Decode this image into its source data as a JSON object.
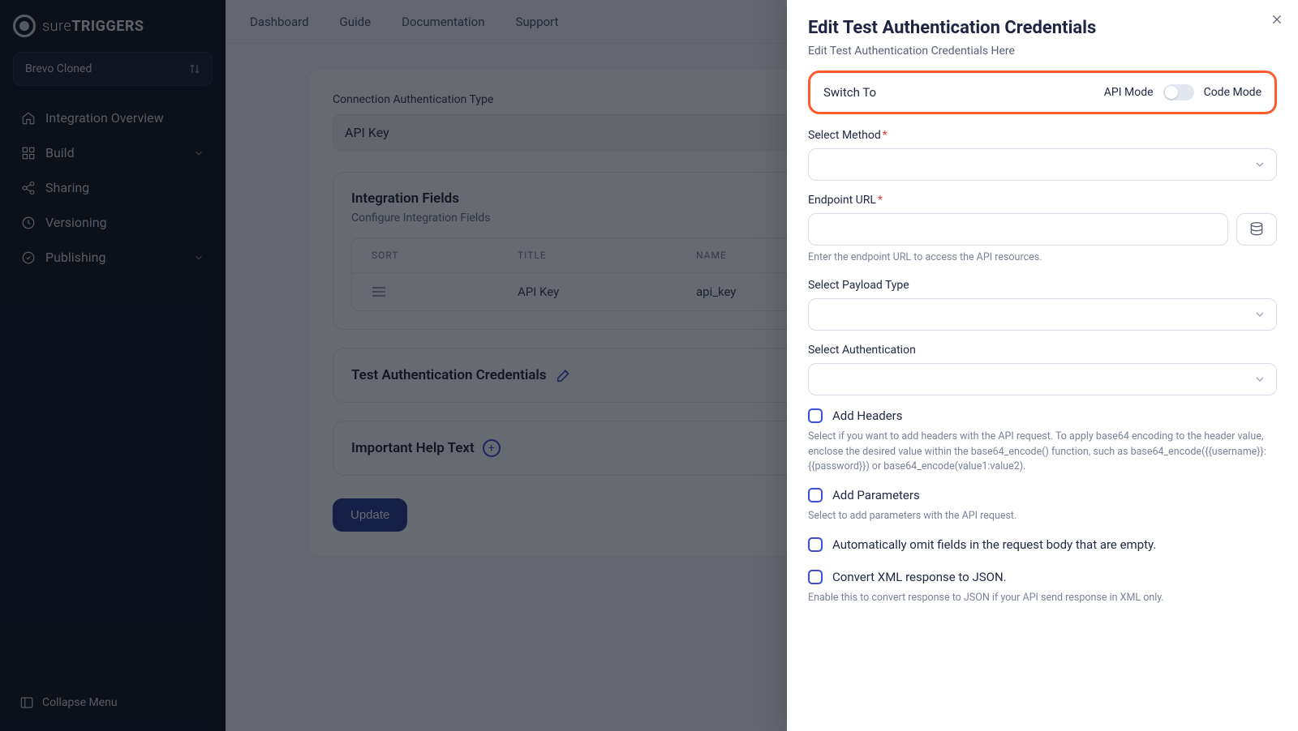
{
  "brand": {
    "prefix": "sure",
    "strong": "TRIGGERS"
  },
  "project": {
    "name": "Brevo Cloned"
  },
  "topnav": {
    "dashboard": "Dashboard",
    "guide": "Guide",
    "documentation": "Documentation",
    "support": "Support"
  },
  "sidebar": {
    "items": [
      {
        "label": "Integration Overview"
      },
      {
        "label": "Build"
      },
      {
        "label": "Sharing"
      },
      {
        "label": "Versioning"
      },
      {
        "label": "Publishing"
      }
    ],
    "footer": "Collapse Menu"
  },
  "main": {
    "conn_label": "Connection Authentication Type",
    "conn_value": "API Key",
    "fields_panel": {
      "title": "Integration Fields",
      "sub": "Configure Integration Fields",
      "thead": {
        "sort": "SORT",
        "title": "TITLE",
        "name": "NAME"
      },
      "row": {
        "title": "API Key",
        "name": "api_key"
      }
    },
    "test_row": {
      "title": "Test Authentication Credentials"
    },
    "help_row": {
      "title": "Important Help Text"
    },
    "update": "Update"
  },
  "drawer": {
    "title": "Edit Test Authentication Credentials",
    "subtitle": "Edit Test Authentication Credentials Here",
    "switch": {
      "label": "Switch To",
      "left": "API Mode",
      "right": "Code Mode"
    },
    "method_label": "Select Method",
    "endpoint_label": "Endpoint URL",
    "endpoint_help": "Enter the endpoint URL to access the API resources.",
    "payload_label": "Select Payload Type",
    "auth_label": "Select Authentication",
    "headers_label": "Add Headers",
    "headers_help": "Select if you want to add headers with the API request. To apply base64 encoding to the header value, enclose the desired value within the base64_encode() function, such as base64_encode({{username}}:{{password}}) or base64_encode(value1:value2).",
    "params_label": "Add Parameters",
    "params_help": "Select to add parameters with the API request.",
    "omit_label": "Automatically omit fields in the request body that are empty.",
    "xml_label": "Convert XML response to JSON.",
    "xml_help": "Enable this to convert response to JSON if your API send response in XML only."
  }
}
